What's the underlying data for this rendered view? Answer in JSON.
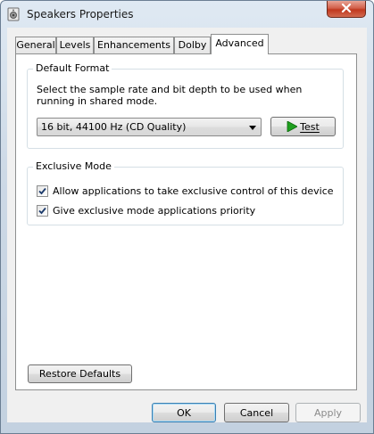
{
  "window": {
    "title": "Speakers Properties"
  },
  "tabs": [
    {
      "label": "General"
    },
    {
      "label": "Levels"
    },
    {
      "label": "Enhancements"
    },
    {
      "label": "Dolby"
    },
    {
      "label": "Advanced",
      "active": true
    }
  ],
  "default_format": {
    "legend": "Default Format",
    "description": "Select the sample rate and bit depth to be used when running in shared mode.",
    "selected_format": "16 bit, 44100 Hz (CD Quality)",
    "test_button": "Test"
  },
  "exclusive_mode": {
    "legend": "Exclusive Mode",
    "options": [
      {
        "label": "Allow applications to take exclusive control of this device",
        "checked": true
      },
      {
        "label": "Give exclusive mode applications priority",
        "checked": true
      }
    ]
  },
  "restore_defaults_label": "Restore Defaults",
  "buttons": {
    "ok": "OK",
    "cancel": "Cancel",
    "apply": "Apply"
  },
  "colors": {
    "play_icon": "#1fa01f",
    "close_button": "#c0391f"
  }
}
